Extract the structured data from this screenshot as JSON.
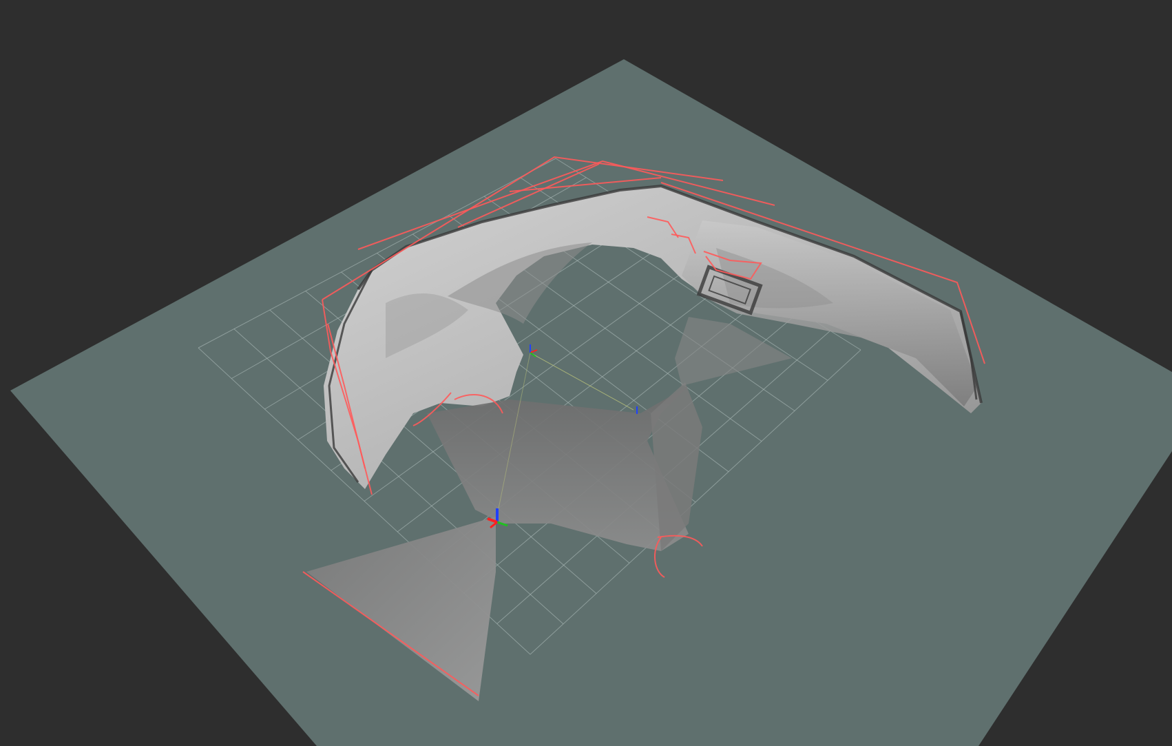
{
  "window": {
    "title": ""
  },
  "scene": {
    "background_color": "#2e2e2e",
    "map_unknown_color": "#5f706e",
    "map_free_color": "#c8c8c8",
    "map_occupied_color": "#3c3c3c",
    "laser_scan_color": "#ff5a5a",
    "grid_color": "#b5c3c1",
    "axis_colors": {
      "x": "#ff2020",
      "y": "#20c020",
      "z": "#2040ff"
    },
    "displays": [
      {
        "name": "grid-icon",
        "kind": "grid"
      },
      {
        "name": "map-icon",
        "kind": "occupancy-grid"
      },
      {
        "name": "laser-scan-icon",
        "kind": "laser-scan"
      },
      {
        "name": "tf-icon",
        "kind": "tf-frames"
      }
    ]
  }
}
